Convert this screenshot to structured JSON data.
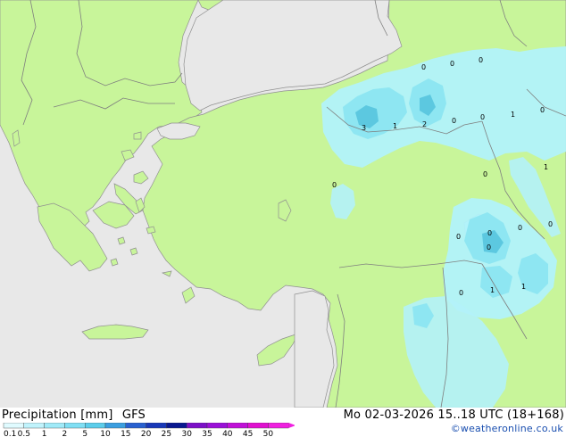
{
  "title": "Precipitation [mm]",
  "model": "GFS",
  "datetime": "Mo 02-03-2026 15..18 UTC (18+168)",
  "credit": "©weatheronline.co.uk",
  "colors": {
    "sea": "#e8e8e8",
    "land": "#c8f59a",
    "border": "#7f7f7f",
    "coast": "#909090",
    "light_precip": "#b2f2fa",
    "mid_precip": "#8ee6f2",
    "heavy_precip": "#5cc8e0"
  },
  "legend": {
    "values": [
      "0.1",
      "0.5",
      "1",
      "2",
      "5",
      "10",
      "15",
      "20",
      "25",
      "30",
      "35",
      "40",
      "45",
      "50"
    ],
    "colors": [
      "#e0fbff",
      "#c0f3fc",
      "#a0eaf8",
      "#80dff4",
      "#5ccdeb",
      "#3a9ee0",
      "#2860d0",
      "#1838b8",
      "#0a1890",
      "#7c10c8",
      "#9a10d8",
      "#c010d8",
      "#e010d0",
      "#f020e0"
    ]
  },
  "precip_values": [
    {
      "id": "a",
      "value": "0"
    },
    {
      "id": "b",
      "value": "0"
    },
    {
      "id": "c",
      "value": "0"
    },
    {
      "id": "d",
      "value": "3"
    },
    {
      "id": "e",
      "value": "1"
    },
    {
      "id": "f",
      "value": "2"
    },
    {
      "id": "g",
      "value": "0"
    },
    {
      "id": "h",
      "value": "0"
    },
    {
      "id": "i",
      "value": "1"
    },
    {
      "id": "j",
      "value": "0"
    },
    {
      "id": "k",
      "value": "0"
    },
    {
      "id": "l",
      "value": "1"
    },
    {
      "id": "m",
      "value": "0"
    },
    {
      "id": "n",
      "value": "0"
    },
    {
      "id": "o",
      "value": "0"
    },
    {
      "id": "p",
      "value": "0"
    },
    {
      "id": "q",
      "value": "0"
    },
    {
      "id": "r",
      "value": "0"
    },
    {
      "id": "s",
      "value": "0"
    },
    {
      "id": "t",
      "value": "1"
    },
    {
      "id": "u",
      "value": "1"
    }
  ]
}
